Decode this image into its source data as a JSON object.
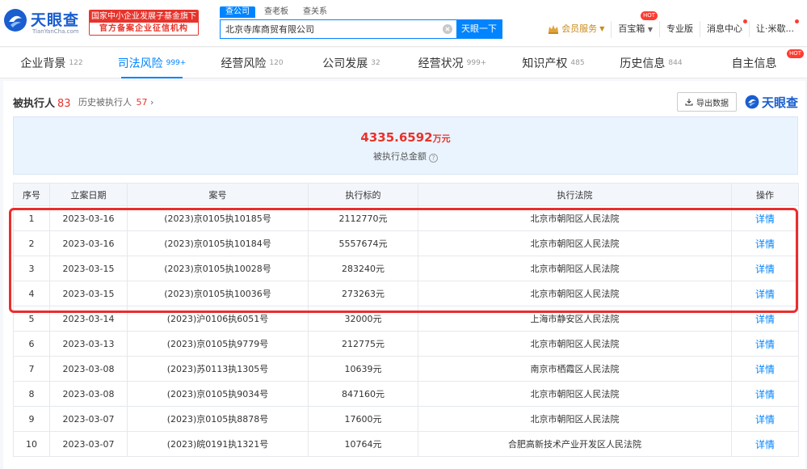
{
  "header": {
    "logo_text": "天眼查",
    "logo_sub": "TianYanCha.com",
    "banner_top": "国家中小企业发展子基金旗下",
    "banner_bottom": "官方备案企业征信机构",
    "search_tabs": [
      "查公司",
      "查老板",
      "查关系"
    ],
    "search_value": "北京寺库商贸有限公司",
    "search_button": "天眼一下",
    "nav": {
      "vip": "会员服务",
      "toolbox": "百宝箱",
      "toolbox_badge": "HOT",
      "pro": "专业版",
      "messages": "消息中心",
      "user": "让·米歇..."
    }
  },
  "tabs": [
    {
      "label": "企业背景",
      "count": "122"
    },
    {
      "label": "司法风险",
      "count": "999+"
    },
    {
      "label": "经营风险",
      "count": "120"
    },
    {
      "label": "公司发展",
      "count": "32"
    },
    {
      "label": "经营状况",
      "count": "999+"
    },
    {
      "label": "知识产权",
      "count": "485"
    },
    {
      "label": "历史信息",
      "count": "844"
    },
    {
      "label": "自主信息",
      "count": "",
      "badge": "HOT"
    }
  ],
  "section": {
    "title": "被执行人",
    "count": "83",
    "history_label": "历史被执行人",
    "history_count": "57",
    "export_label": "导出数据",
    "brand": "天眼查"
  },
  "summary": {
    "amount": "4335.6592",
    "unit": "万元",
    "label": "被执行总金额"
  },
  "table": {
    "headers": [
      "序号",
      "立案日期",
      "案号",
      "执行标的",
      "执行法院",
      "操作"
    ],
    "rows": [
      {
        "no": "1",
        "date": "2023-03-16",
        "case": "(2023)京0105执10185号",
        "amount": "2112770元",
        "court": "北京市朝阳区人民法院",
        "action": "详情"
      },
      {
        "no": "2",
        "date": "2023-03-16",
        "case": "(2023)京0105执10184号",
        "amount": "5557674元",
        "court": "北京市朝阳区人民法院",
        "action": "详情"
      },
      {
        "no": "3",
        "date": "2023-03-15",
        "case": "(2023)京0105执10028号",
        "amount": "283240元",
        "court": "北京市朝阳区人民法院",
        "action": "详情"
      },
      {
        "no": "4",
        "date": "2023-03-15",
        "case": "(2023)京0105执10036号",
        "amount": "273263元",
        "court": "北京市朝阳区人民法院",
        "action": "详情"
      },
      {
        "no": "5",
        "date": "2023-03-14",
        "case": "(2023)沪0106执6051号",
        "amount": "32000元",
        "court": "上海市静安区人民法院",
        "action": "详情"
      },
      {
        "no": "6",
        "date": "2023-03-13",
        "case": "(2023)京0105执9779号",
        "amount": "212775元",
        "court": "北京市朝阳区人民法院",
        "action": "详情"
      },
      {
        "no": "7",
        "date": "2023-03-08",
        "case": "(2023)苏0113执1305号",
        "amount": "10639元",
        "court": "南京市栖霞区人民法院",
        "action": "详情"
      },
      {
        "no": "8",
        "date": "2023-03-08",
        "case": "(2023)京0105执9034号",
        "amount": "847160元",
        "court": "北京市朝阳区人民法院",
        "action": "详情"
      },
      {
        "no": "9",
        "date": "2023-03-07",
        "case": "(2023)京0105执8878号",
        "amount": "17600元",
        "court": "北京市朝阳区人民法院",
        "action": "详情"
      },
      {
        "no": "10",
        "date": "2023-03-07",
        "case": "(2023)皖0191执1321号",
        "amount": "10764元",
        "court": "合肥高新技术产业开发区人民法院",
        "action": "详情"
      }
    ]
  }
}
